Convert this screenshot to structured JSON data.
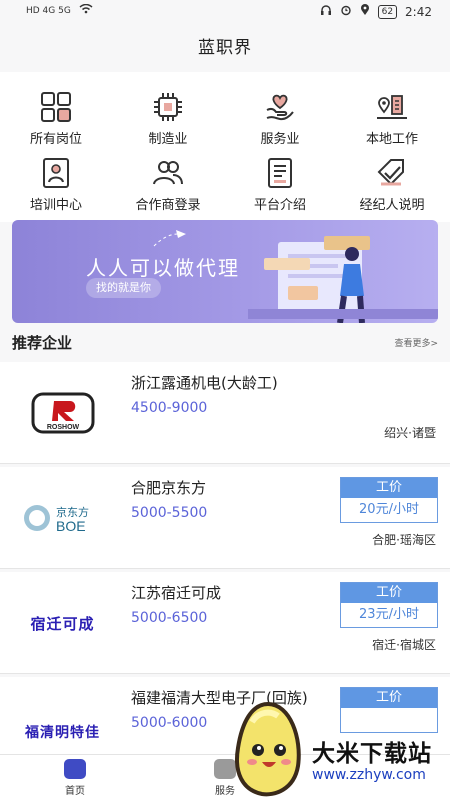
{
  "status_bar": {
    "time": "2:42",
    "battery": "62",
    "left_indicators": "HD 4G 5G"
  },
  "app": {
    "title": "蓝职界"
  },
  "categories": [
    {
      "label": "所有岗位",
      "icon": "grid-icon"
    },
    {
      "label": "制造业",
      "icon": "chip-icon"
    },
    {
      "label": "服务业",
      "icon": "heart-hand-icon"
    },
    {
      "label": "本地工作",
      "icon": "location-building-icon"
    },
    {
      "label": "培训中心",
      "icon": "training-portrait-icon"
    },
    {
      "label": "合作商登录",
      "icon": "people-icon"
    },
    {
      "label": "平台介绍",
      "icon": "document-icon"
    },
    {
      "label": "经纪人说明",
      "icon": "tag-check-icon"
    }
  ],
  "banner": {
    "headline": "人人可以做代理",
    "subtitle": "找的就是你"
  },
  "section": {
    "title": "推荐企业",
    "more": "查看更多>"
  },
  "companies": [
    {
      "name": "浙江露通机电(大龄工)",
      "salary": "4500-9000",
      "location": "绍兴·诸暨",
      "logo_text": "ROSHOW",
      "pay": null
    },
    {
      "name": "合肥京东方",
      "salary": "5000-5500",
      "location": "合肥·瑶海区",
      "logo_text_top": "京东方",
      "logo_text_bottom": "BOE",
      "pay": {
        "title": "工价",
        "value": "20元/小时"
      }
    },
    {
      "name": "江苏宿迁可成",
      "salary": "5000-6500",
      "location": "宿迁·宿城区",
      "logo_text": "宿迁可成",
      "pay": {
        "title": "工价",
        "value": "23元/小时"
      }
    },
    {
      "name": "福建福清大型电子厂(回族)",
      "salary": "5000-6000",
      "location": "",
      "logo_text": "福清明特佳",
      "pay": {
        "title": "工价",
        "value": ""
      }
    }
  ],
  "tabbar": {
    "home": "首页",
    "service": "服务"
  },
  "watermark": {
    "text": "大米下载站",
    "url": "www.zzhyw.com"
  },
  "colors": {
    "accent": "#5b63d8",
    "pay_blue": "#5f97e3",
    "banner": "#a49ae6"
  }
}
